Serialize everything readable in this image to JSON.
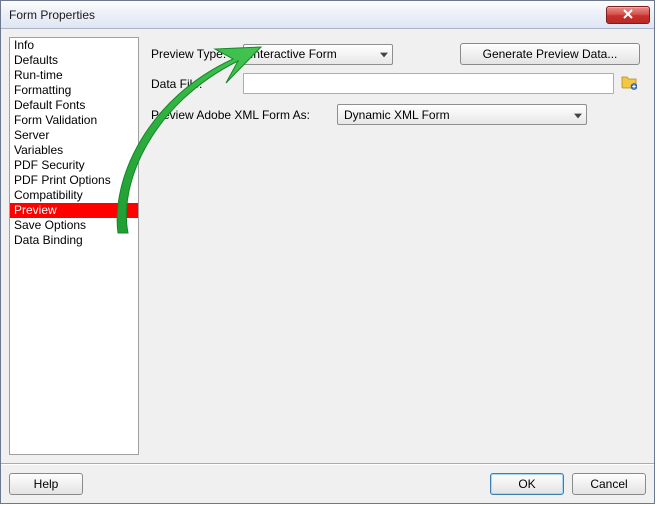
{
  "window": {
    "title": "Form Properties"
  },
  "sidebar": {
    "items": [
      {
        "label": "Info"
      },
      {
        "label": "Defaults"
      },
      {
        "label": "Run-time"
      },
      {
        "label": "Formatting"
      },
      {
        "label": "Default Fonts"
      },
      {
        "label": "Form Validation"
      },
      {
        "label": "Server"
      },
      {
        "label": "Variables"
      },
      {
        "label": "PDF Security"
      },
      {
        "label": "PDF Print Options"
      },
      {
        "label": "Compatibility"
      },
      {
        "label": "Preview",
        "selected": true
      },
      {
        "label": "Save Options"
      },
      {
        "label": "Data Binding"
      }
    ]
  },
  "content": {
    "previewType": {
      "label": "Preview Type:",
      "value": "Interactive Form"
    },
    "generateBtn": "Generate Preview Data...",
    "dataFile": {
      "label": "Data File:",
      "value": ""
    },
    "previewAdobe": {
      "label": "Preview Adobe XML Form As:",
      "value": "Dynamic XML Form"
    }
  },
  "footer": {
    "help": "Help",
    "ok": "OK",
    "cancel": "Cancel"
  }
}
